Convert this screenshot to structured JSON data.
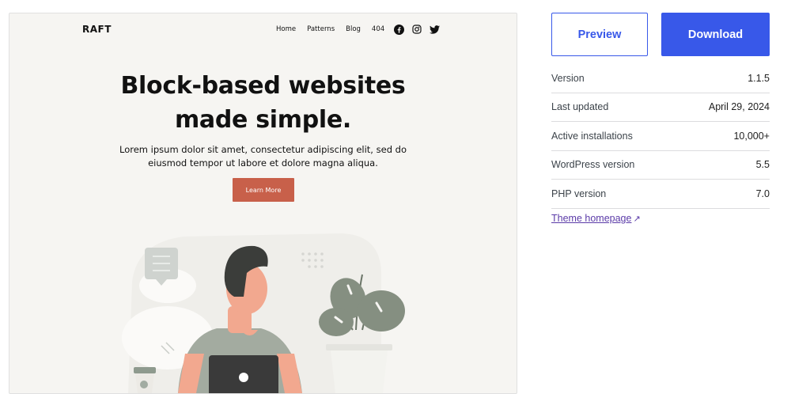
{
  "theme_preview": {
    "site_title": "RAFT",
    "nav": [
      "Home",
      "Patterns",
      "Blog",
      "404"
    ],
    "social_icons": [
      "facebook-icon",
      "instagram-icon",
      "twitter-icon"
    ],
    "hero_heading_line1": "Block-based websites",
    "hero_heading_line2": "made simple.",
    "hero_text_line1": "Lorem ipsum dolor sit amet, consectetur adipiscing elit, sed do",
    "hero_text_line2": "eiusmod tempor ut labore et dolore magna aliqua.",
    "cta_label": "Learn More"
  },
  "actions": {
    "preview_label": "Preview",
    "download_label": "Download"
  },
  "meta": [
    {
      "label": "Version",
      "value": "1.1.5"
    },
    {
      "label": "Last updated",
      "value": "April 29, 2024"
    },
    {
      "label": "Active installations",
      "value": "10,000+"
    },
    {
      "label": "WordPress version",
      "value": "5.5"
    },
    {
      "label": "PHP version",
      "value": "7.0"
    }
  ],
  "homepage_link": {
    "label": "Theme homepage",
    "icon": "external-arrow-icon"
  },
  "colors": {
    "accent": "#3858e9",
    "cta": "#c8604a",
    "preview_bg": "#f6f5f2",
    "link_visited": "#5b3ba8"
  }
}
